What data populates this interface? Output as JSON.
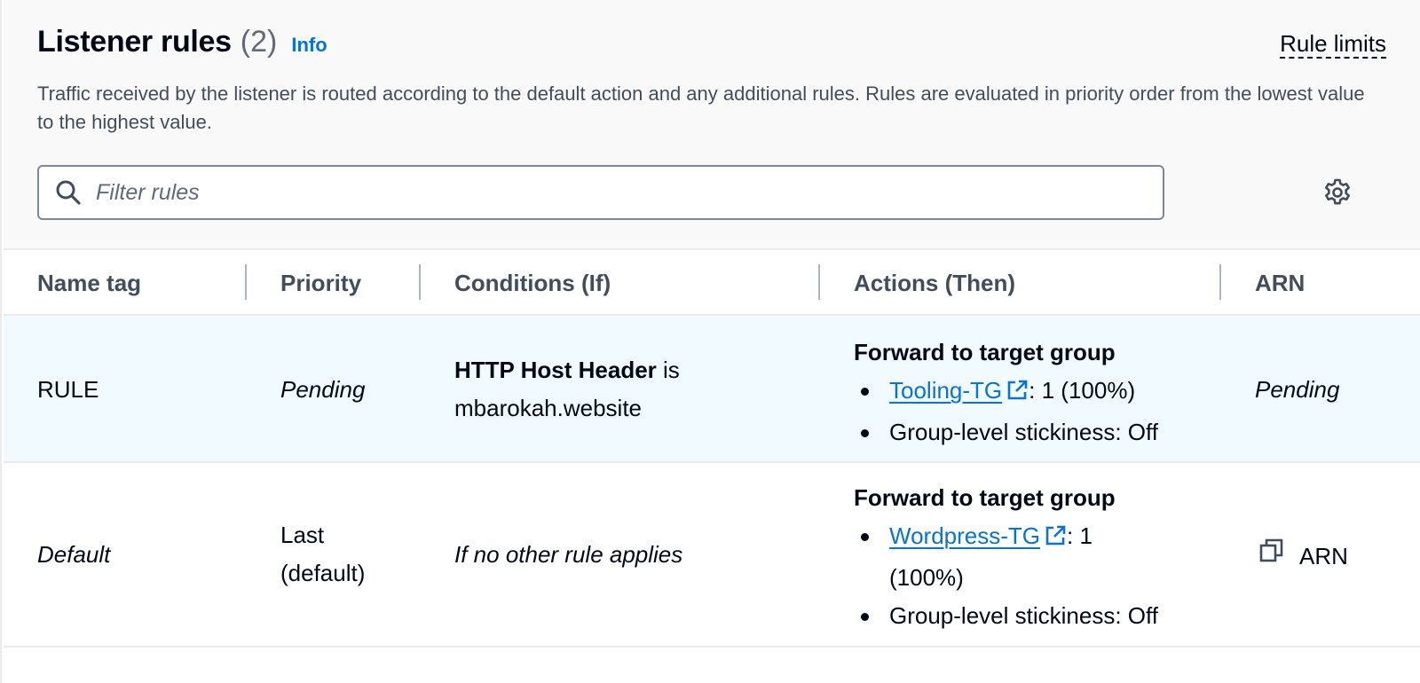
{
  "header": {
    "title": "Listener rules",
    "count": "(2)",
    "info_label": "Info",
    "rule_limits_label": "Rule limits",
    "description": "Traffic received by the listener is routed according to the default action and any additional rules. Rules are evaluated in priority order from the lowest value to the highest value."
  },
  "search": {
    "placeholder": "Filter rules",
    "value": ""
  },
  "table": {
    "columns": [
      "Name tag",
      "Priority",
      "Conditions (If)",
      "Actions (Then)",
      "ARN"
    ],
    "rows": [
      {
        "name_tag": "RULE",
        "priority": "Pending",
        "condition_bold": "HTTP Host Header",
        "condition_op": " is",
        "condition_value": "mbarokah.website",
        "action_title": "Forward to target group",
        "target_group": "Tooling-TG",
        "target_weight": ": 1 (100%)",
        "stickiness": "Group-level stickiness: Off",
        "arn": "Pending"
      },
      {
        "name_tag": "Default",
        "priority_line1": "Last",
        "priority_line2": "(default)",
        "condition": "If no other rule applies",
        "action_title": "Forward to target group",
        "target_group": "Wordpress-TG",
        "target_weight_line1": ": 1",
        "target_weight_line2": "(100%)",
        "stickiness": "Group-level stickiness: Off",
        "arn_button": "ARN"
      }
    ]
  },
  "icons": {
    "search": "search-icon",
    "settings": "gear-icon",
    "external_link": "external-link-icon",
    "copy": "copy-icon"
  },
  "colors": {
    "link": "#0972d3",
    "selected_row": "#f1faff",
    "text": "#000716",
    "header_text": "#414d5c"
  }
}
